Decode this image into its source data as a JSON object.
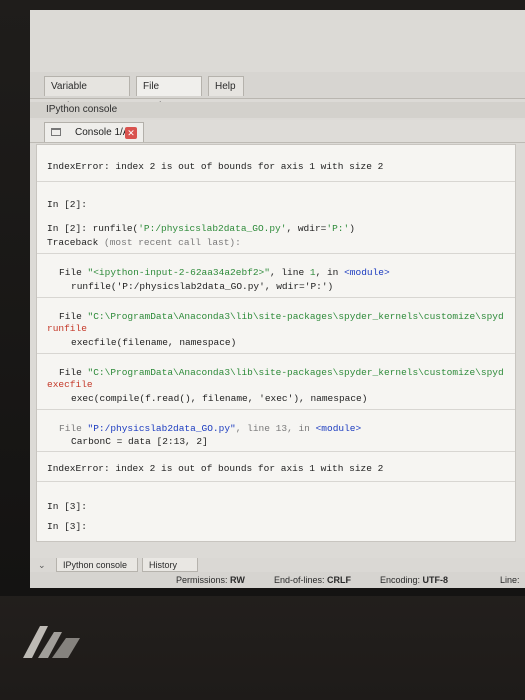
{
  "top_tabs": [
    "Variable explorer",
    "File explorer",
    "Help"
  ],
  "panel_title": "IPython console",
  "console_tab": {
    "label": "Console 1/A",
    "close_icon": "x-icon"
  },
  "console_lines": {
    "l1": "IndexError: index 2 is out of bounds for axis 1 with size 2",
    "l2": "In [2]:",
    "l3a": "In [2]: runfile(",
    "l3b": "'P:/physicslab2data_GO.py'",
    "l3c": ", wdir=",
    "l3d": "'P:'",
    "l3e": ")",
    "l4a": "Traceback ",
    "l4b": "(most recent call last):",
    "l5a": "File ",
    "l5b": "\"<ipython-input-2-62aa34a2ebf2>\"",
    "l5c": ", line ",
    "l5d": "1",
    "l5e": ", in ",
    "l5f": "<module>",
    "l6": "runfile('P:/physicslab2data_GO.py', wdir='P:')",
    "l7a": "File ",
    "l7b": "\"C:\\ProgramData\\Anaconda3\\lib\\site-packages\\spyder_kernels\\customize\\spyd",
    "l8": "runfile",
    "l9": "execfile(filename, namespace)",
    "l10a": "File ",
    "l10b": "\"C:\\ProgramData\\Anaconda3\\lib\\site-packages\\spyder_kernels\\customize\\spyd",
    "l11": "execfile",
    "l12": "exec(compile(f.read(), filename, 'exec'), namespace)",
    "l13a": "File ",
    "l13b": "\"P:/physicslab2data_GO.py\"",
    "l13c": ", line ",
    "l13d": "13",
    "l13e": ", in ",
    "l13f": "<module>",
    "l14": "CarbonC = data [2:13, 2]",
    "l15": "IndexError: index 2 is out of bounds for axis 1 with size 2",
    "l16": "In [3]:",
    "l17": "In [3]:"
  },
  "bottom_tabs": [
    "IPython console",
    "History log"
  ],
  "status": {
    "perm_label": "Permissions:",
    "perm_value": "RW",
    "eol_label": "End-of-lines:",
    "eol_value": "CRLF",
    "enc_label": "Encoding:",
    "enc_value": "UTF-8",
    "line_label": "Line:"
  },
  "colors": {
    "accent_close": "#d9534f",
    "link_green": "#2e8b3a",
    "keyword_blue": "#1c3cc0"
  }
}
